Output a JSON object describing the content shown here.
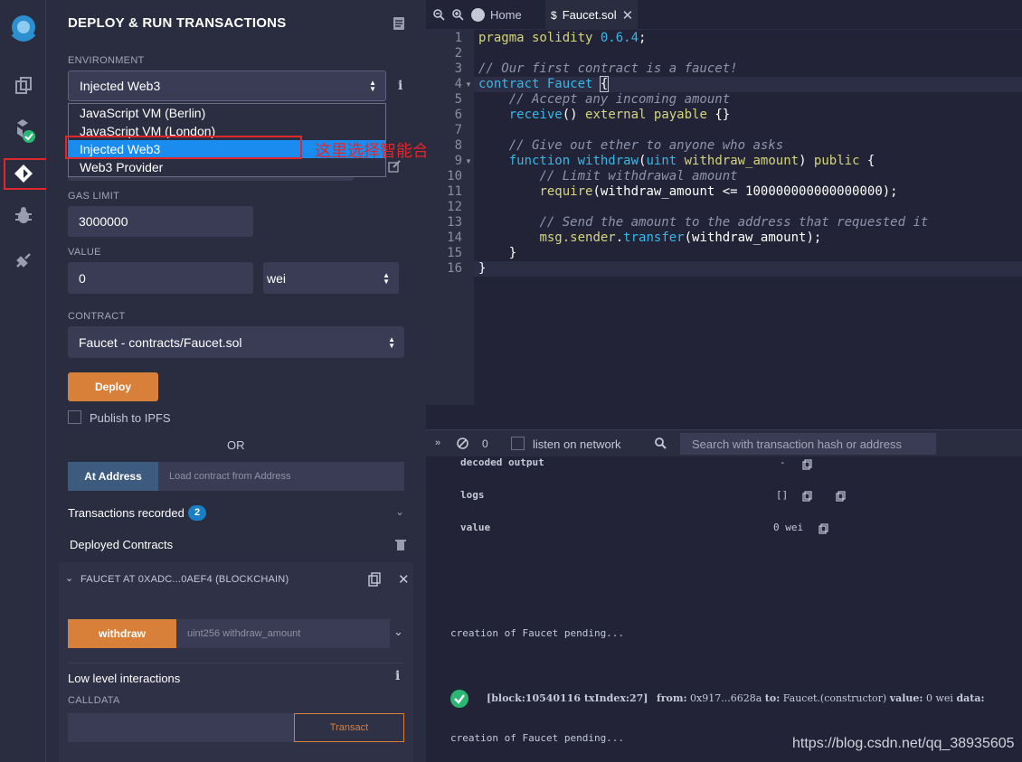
{
  "sidebar": {
    "icons": [
      "remix-logo-icon",
      "file-explorer-icon",
      "compiler-icon",
      "deploy-run-icon",
      "debugger-icon",
      "plugin-manager-icon"
    ]
  },
  "panel": {
    "title": "DEPLOY & RUN TRANSACTIONS",
    "environment_label": "ENVIRONMENT",
    "environment_value": "Injected Web3",
    "environment_options": [
      "JavaScript VM (Berlin)",
      "JavaScript VM (London)",
      "Injected Web3",
      "Web3 Provider"
    ],
    "annotation": "这里选择智能合约",
    "gas_limit_label": "GAS LIMIT",
    "gas_limit_value": "3000000",
    "value_label": "VALUE",
    "value_amount": "0",
    "value_unit": "wei",
    "contract_label": "CONTRACT",
    "contract_value": "Faucet - contracts/Faucet.sol",
    "deploy_label": "Deploy",
    "publish_label": "Publish to IPFS",
    "or_label": "OR",
    "at_address_label": "At Address",
    "at_address_placeholder": "Load contract from Address",
    "transactions_label": "Transactions recorded",
    "transactions_count": "2",
    "deployed_label": "Deployed Contracts",
    "instance_label": "FAUCET AT 0XADC...0AEF4 (BLOCKCHAIN)",
    "withdraw_label": "withdraw",
    "withdraw_placeholder": "uint256 withdraw_amount",
    "low_level_label": "Low level interactions",
    "calldata_label": "CALLDATA",
    "transact_label": "Transact"
  },
  "editor": {
    "tab_home": "Home",
    "tab_file": "Faucet.sol",
    "lines": [
      "1",
      "2",
      "3",
      "4",
      "5",
      "6",
      "7",
      "8",
      "9",
      "10",
      "11",
      "12",
      "13",
      "14",
      "15",
      "16"
    ]
  },
  "terminal": {
    "count": "0",
    "listen_label": "listen on network",
    "search_placeholder": "Search with transaction hash or address",
    "decoded_output_key": "decoded output",
    "decoded_output_val": "-",
    "logs_key": "logs",
    "logs_val": "[]",
    "value_key": "value",
    "value_val": "0 wei",
    "pending_1": "creation of Faucet pending...",
    "tx_block": "[block:10540116 txIndex:27]",
    "tx_from_label": "from:",
    "tx_from": "0x917...6628a",
    "tx_to_label": "to:",
    "tx_to": "Faucet.(constructor)",
    "tx_value_label": "value:",
    "tx_value": "0 wei",
    "tx_data_label": "data:",
    "pending_2": "creation of Faucet pending...",
    "watermark": "https://blog.csdn.net/qq_38935605"
  },
  "colors": {
    "accent": "#d8803a",
    "selection": "#1a8cf0",
    "annotation": "#e0272b",
    "success": "#2bb673"
  }
}
